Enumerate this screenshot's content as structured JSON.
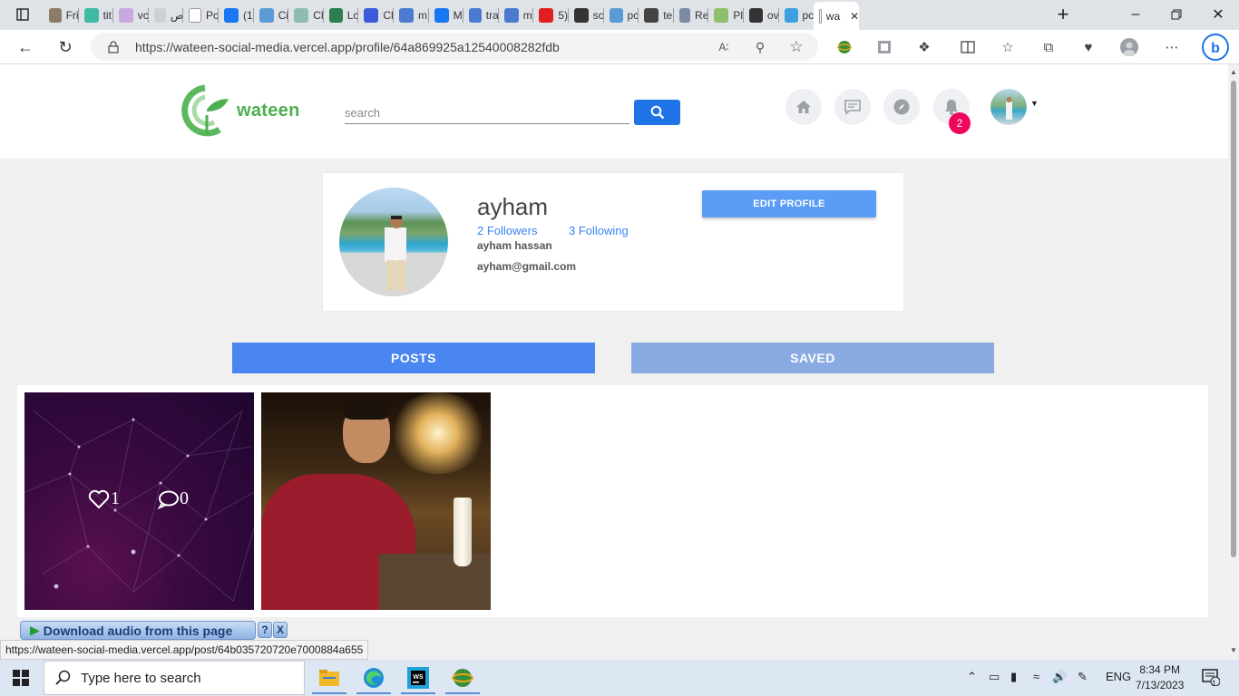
{
  "browser": {
    "tabs": [
      {
        "label": "Fri",
        "color": "#8d7b6a"
      },
      {
        "label": "tit",
        "color": "#3fb9a0"
      },
      {
        "label": "vc",
        "color": "#c9a8e0"
      },
      {
        "label": "ص",
        "color": "#d0d0d0"
      },
      {
        "label": "Pc",
        "color": "#ffffff"
      },
      {
        "label": "(1",
        "color": "#1877f2"
      },
      {
        "label": "Ci",
        "color": "#5b9bd5"
      },
      {
        "label": "Cl",
        "color": "#8fbcb0"
      },
      {
        "label": "Lc",
        "color": "#2e7d4f"
      },
      {
        "label": "Cl",
        "color": "#3b5bdb"
      },
      {
        "label": "m",
        "color": "#4a7bd0"
      },
      {
        "label": "M",
        "color": "#1877f2"
      },
      {
        "label": "tra",
        "color": "#4a7bd0"
      },
      {
        "label": "m",
        "color": "#4a7bd0"
      },
      {
        "label": "5)",
        "color": "#e02020"
      },
      {
        "label": "sc",
        "color": "#333333"
      },
      {
        "label": "pc",
        "color": "#5b9bd5"
      },
      {
        "label": "te",
        "color": "#444444"
      },
      {
        "label": "Re",
        "color": "#7a8aa0"
      },
      {
        "label": "Pl",
        "color": "#8fbf6a"
      },
      {
        "label": "ov",
        "color": "#333333"
      },
      {
        "label": "pc",
        "color": "#3fa0e0"
      },
      {
        "label": "wa",
        "color": "#ffffff"
      }
    ],
    "url": "https://wateen-social-media.vercel.app/profile/64a869925a12540008282fdb",
    "status_url": "https://wateen-social-media.vercel.app/post/64b035720720e7000884a655"
  },
  "header": {
    "logo_text": "wateen",
    "search_placeholder": "search",
    "notification_count": "2"
  },
  "profile": {
    "username": "ayham",
    "followers": "2 Followers",
    "following": "3 Following",
    "full_name": "ayham hassan",
    "email": "ayham@gmail.com",
    "edit_button": "EDIT PROFILE"
  },
  "tabs": {
    "posts": "POSTS",
    "saved": "SAVED"
  },
  "posts": [
    {
      "likes": "1",
      "comments": "0"
    }
  ],
  "download_bar": {
    "label": "Download audio from this page",
    "help": "?",
    "close": "X"
  },
  "taskbar": {
    "search_placeholder": "Type here to search",
    "language": "ENG",
    "time": "8:34 PM",
    "date": "7/13/2023",
    "notification_count": "1"
  }
}
